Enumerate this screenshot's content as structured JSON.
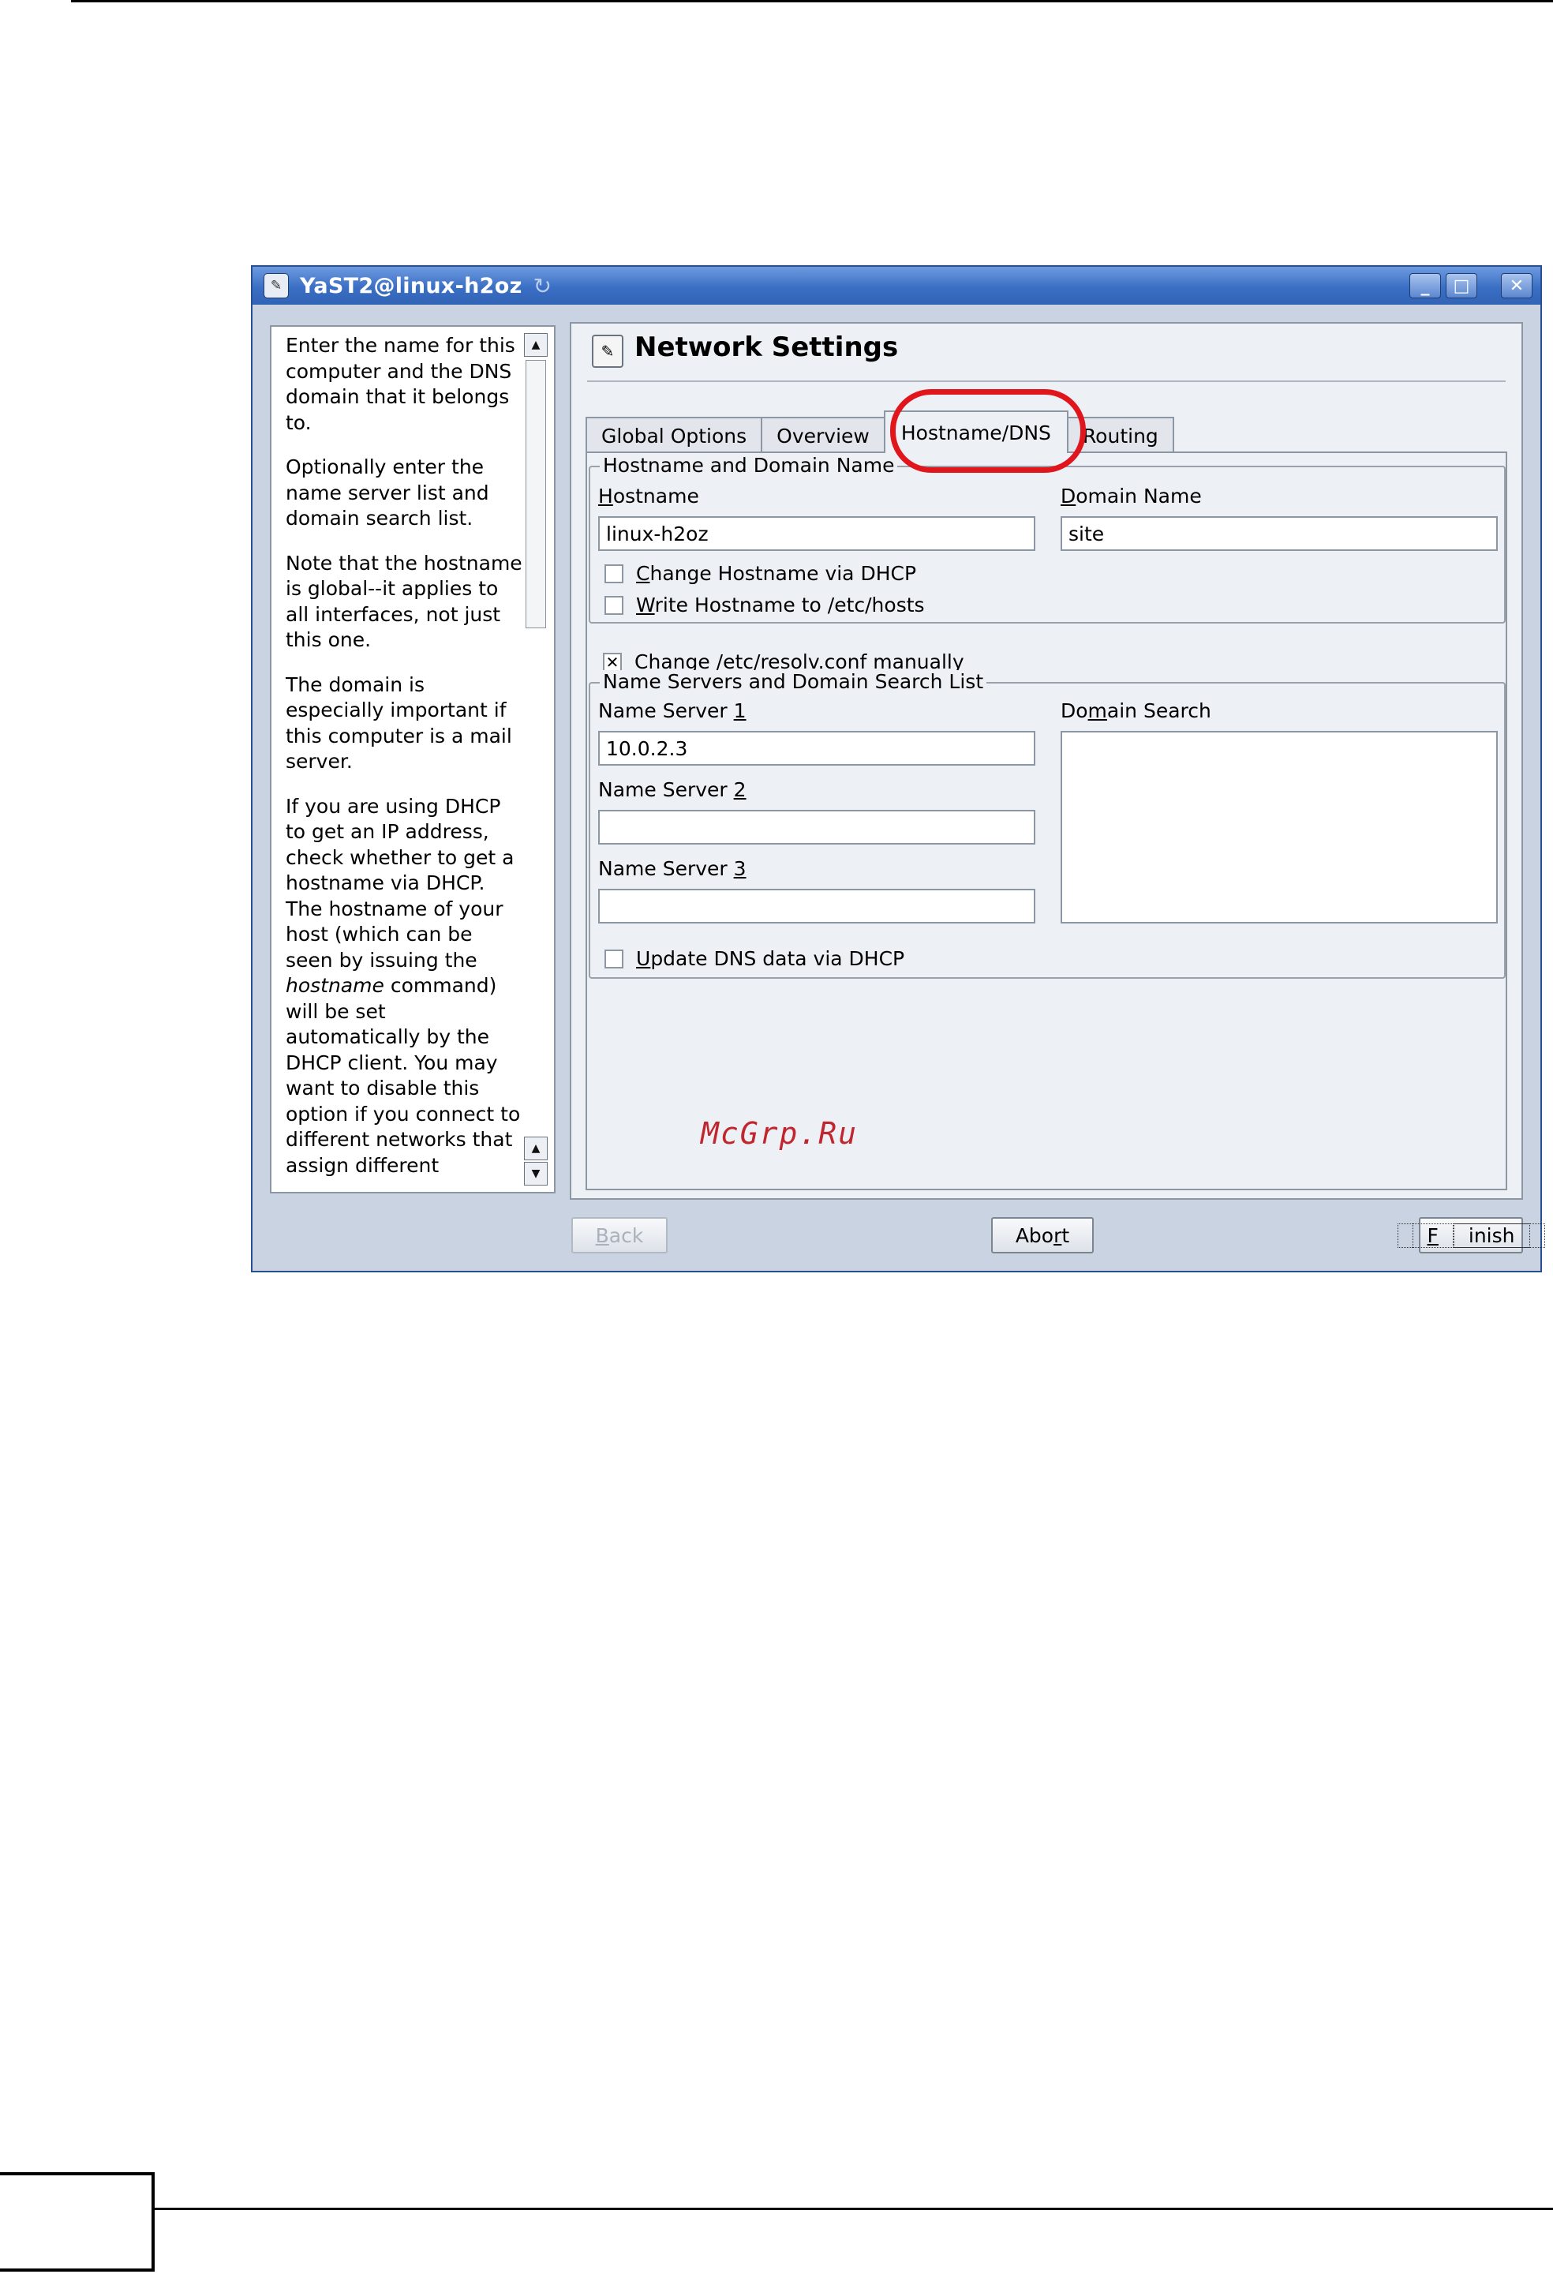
{
  "window": {
    "title": "YaST2@linux-h2oz",
    "minimize": "_",
    "maximize": "□",
    "close": "✕"
  },
  "help": {
    "paragraphs": [
      "Enter the name for this computer and the DNS domain that it belongs to.",
      "Optionally enter the name server list and domain search list.",
      "Note that the hostname is global--it applies to all interfaces, not just this one.",
      "The domain is especially important if this computer is a mail server."
    ],
    "para5_before": "If you are using DHCP to get an IP address, check whether to get a hostname via DHCP. The hostname of your host (which can be seen by issuing the ",
    "para5_em": "hostname",
    "para5_after": " command) will be set automatically by the DHCP client. You may want to disable this option if you connect to different networks that assign different"
  },
  "main": {
    "title": "Network Settings",
    "tabs": [
      "Global Options",
      "Overview",
      "Hostname/DNS",
      "Routing"
    ],
    "group1": {
      "legend": "Hostname and Domain Name",
      "hostname_label": {
        "u": "H",
        "rest": "ostname"
      },
      "hostname_value": "linux-h2oz",
      "domain_label": {
        "u": "D",
        "rest": "omain Name"
      },
      "domain_value": "site",
      "cb_change_hostname": {
        "u": "C",
        "rest": "hange Hostname via DHCP"
      },
      "cb_write_hostname": {
        "u": "W",
        "rest": "rite Hostname to /etc/hosts"
      }
    },
    "resolv": {
      "pre": "Ch",
      "u": "a",
      "rest": "nge /etc/resolv.conf manually"
    },
    "group2": {
      "legend": "Name Servers and Domain Search List",
      "ns1_label": {
        "pre": "Name Server ",
        "u": "1"
      },
      "ns1_value": "10.0.2.3",
      "ns2_label": {
        "pre": "Name Server ",
        "u": "2"
      },
      "ns3_label": {
        "pre": "Name Server ",
        "u": "3"
      },
      "domain_search_label": {
        "pre": "Do",
        "u": "m",
        "rest": "ain Search"
      },
      "cb_update_dns": {
        "u": "U",
        "rest": "pdate DNS data via DHCP"
      }
    }
  },
  "watermark": "McGrp.Ru",
  "buttons": {
    "back": {
      "u": "B",
      "rest": "ack"
    },
    "abort": {
      "pre": "Abo",
      "u": "r",
      "rest": "t"
    },
    "finish": {
      "u": "F",
      "rest": "inish"
    }
  }
}
